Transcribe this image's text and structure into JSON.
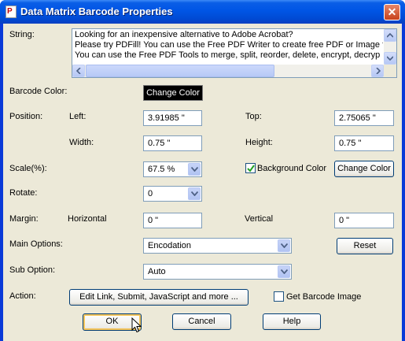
{
  "window": {
    "title": "Data Matrix Barcode Properties",
    "icon_letter": "P",
    "close_label": "✕"
  },
  "string": {
    "label": "String:",
    "lines": [
      "Looking for an inexpensive alternative to Adobe Acrobat?",
      "Please try PDFill! You can use the Free PDF Writer to create free PDF or Image f",
      "You can use the Free PDF Tools to merge, split, reorder, delete, encrypt, decryp"
    ]
  },
  "barcode_color": {
    "label": "Barcode Color:",
    "button": "Change Color"
  },
  "position": {
    "label": "Position:",
    "left_label": "Left:",
    "left_value": "3.91985 \"",
    "top_label": "Top:",
    "top_value": "2.75065 \"",
    "width_label": "Width:",
    "width_value": "0.75 \"",
    "height_label": "Height:",
    "height_value": "0.75 \""
  },
  "scale": {
    "label": "Scale(%):",
    "value": "67.5 %",
    "background_color_label": "Background Color",
    "background_checked": true,
    "change_color_button": "Change Color"
  },
  "rotate": {
    "label": "Rotate:",
    "value": "0"
  },
  "margin": {
    "label": "Margin:",
    "horizontal_label": "Horizontal",
    "horizontal_value": "0 \"",
    "vertical_label": "Vertical",
    "vertical_value": "0 \""
  },
  "main_options": {
    "label": "Main Options:",
    "value": "Encodation",
    "reset_button": "Reset"
  },
  "sub_option": {
    "label": "Sub Option:",
    "value": "Auto"
  },
  "action": {
    "label": "Action:",
    "edit_button": "Edit Link, Submit, JavaScript and more ...",
    "get_image_label": "Get Barcode Image",
    "get_image_checked": false
  },
  "footer": {
    "ok": "OK",
    "cancel": "Cancel",
    "help": "Help"
  },
  "icons": [
    "pdf-app-icon",
    "close-icon",
    "scroll-up-icon",
    "scroll-down-icon",
    "scroll-left-icon",
    "scroll-right-icon",
    "dropdown-arrow-icon",
    "checkmark-icon",
    "mouse-cursor-icon"
  ]
}
